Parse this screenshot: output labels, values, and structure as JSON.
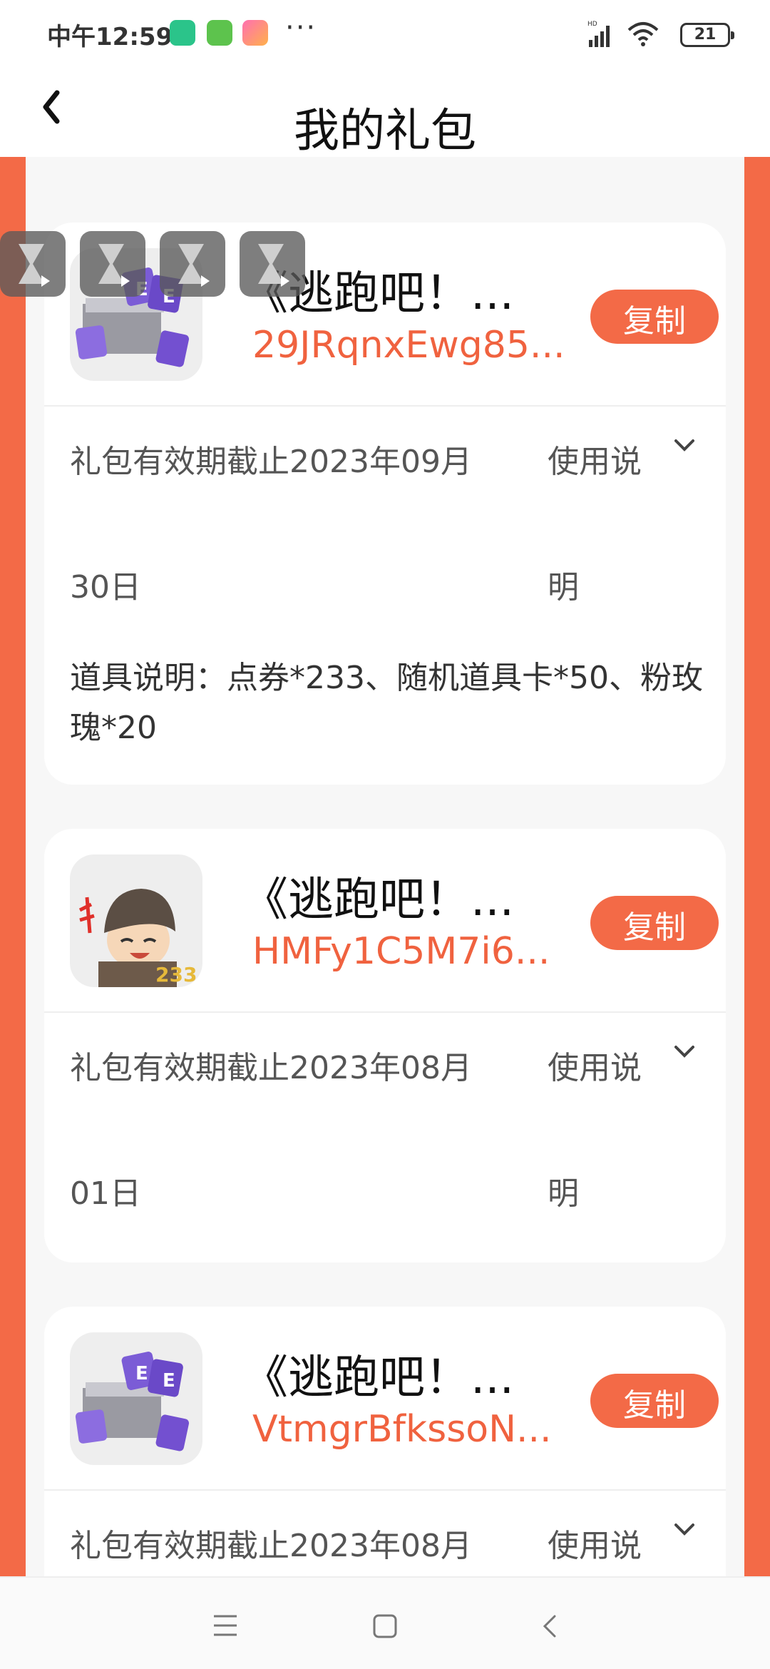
{
  "status_bar": {
    "time": "中午12:59",
    "dots": "···",
    "battery": "21",
    "network": "HD"
  },
  "header": {
    "title": "我的礼包"
  },
  "cards": [
    {
      "name": "《逃跑吧！...",
      "code": "29JRqnxEwg85...",
      "copy_label": "复制",
      "valid_line1": "礼包有效期截止2023年09月",
      "valid_line2": "30日",
      "usage_line1": "使用说",
      "usage_line2": "明",
      "desc": "道具说明：点券*233、随机道具卡*50、粉玫瑰*20",
      "icon": "gift-box-icon"
    },
    {
      "name": "《逃跑吧！...",
      "code": "HMFy1C5M7i6...",
      "copy_label": "复制",
      "valid_line1": "礼包有效期截止2023年08月",
      "valid_line2": "01日",
      "usage_line1": "使用说",
      "usage_line2": "明",
      "icon": "character-icon"
    },
    {
      "name": "《逃跑吧！...",
      "code": "VtmgrBfkssoN...",
      "copy_label": "复制",
      "valid_line1": "礼包有效期截止2023年08月",
      "usage_line1": "使用说",
      "icon": "gift-box-icon"
    }
  ],
  "colors": {
    "accent": "#f36a47",
    "code": "#f0623f"
  }
}
